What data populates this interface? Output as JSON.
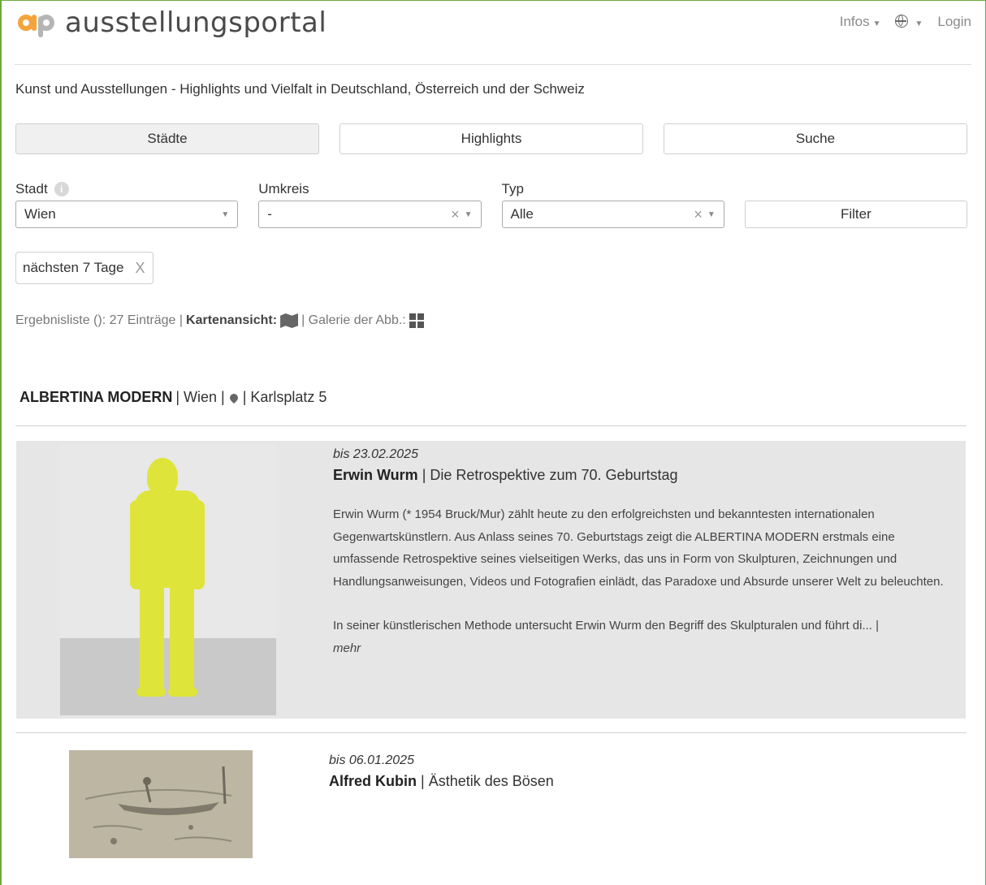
{
  "header": {
    "logo_text": "ausstellungsportal",
    "nav": {
      "infos": "Infos",
      "login": "Login"
    }
  },
  "tagline": "Kunst und Ausstellungen - Highlights und Vielfalt in Deutschland, Österreich und der Schweiz",
  "tabs": [
    {
      "label": "Städte",
      "active": true
    },
    {
      "label": "Highlights",
      "active": false
    },
    {
      "label": "Suche",
      "active": false
    }
  ],
  "filters": {
    "stadt": {
      "label": "Stadt",
      "value": "Wien"
    },
    "umkreis": {
      "label": "Umkreis",
      "value": "-"
    },
    "typ": {
      "label": "Typ",
      "value": "Alle"
    },
    "filter_button": "Filter"
  },
  "chip": {
    "label": "nächsten 7 Tage",
    "close": "X"
  },
  "results": {
    "prefix": "Ergebnisliste (): 27 Einträge |",
    "map_label": "Kartenansicht:",
    "gallery_label": "| Galerie der Abb.:"
  },
  "venue": {
    "name": "ALBERTINA MODERN",
    "city": "| Wien |",
    "address": "| Karlsplatz 5"
  },
  "exhibitions": [
    {
      "date": "bis 23.02.2025",
      "artist": "Erwin Wurm",
      "subtitle": "| Die Retrospektive zum 70. Geburtstag",
      "para1": "Erwin Wurm (* 1954 Bruck/Mur) zählt heute zu den erfolgreichsten und bekanntesten internationalen Gegenwartskünstlern. Aus Anlass seines 70. Geburtstags zeigt die ALBERTINA MODERN erstmals eine umfassende Retrospektive seines vielseitigen Werks, das uns in Form von Skulpturen, Zeichnungen und Handlungsanweisungen, Videos und Fotografien einlädt, das Paradoxe und Absurde unserer Welt zu beleuchten.",
      "para2": "In seiner künstlerischen Methode untersucht Erwin Wurm den Begriff des Skulpturalen und führt di... |",
      "more": "mehr"
    },
    {
      "date": "bis 06.01.2025",
      "artist": "Alfred Kubin",
      "subtitle": "| Ästhetik des Bösen"
    }
  ],
  "colors": {
    "accent_orange": "#f5a33b",
    "logo_grey": "#b5b5b5",
    "frame_green": "#6aab3a",
    "card_bg": "#e6e6e6"
  }
}
